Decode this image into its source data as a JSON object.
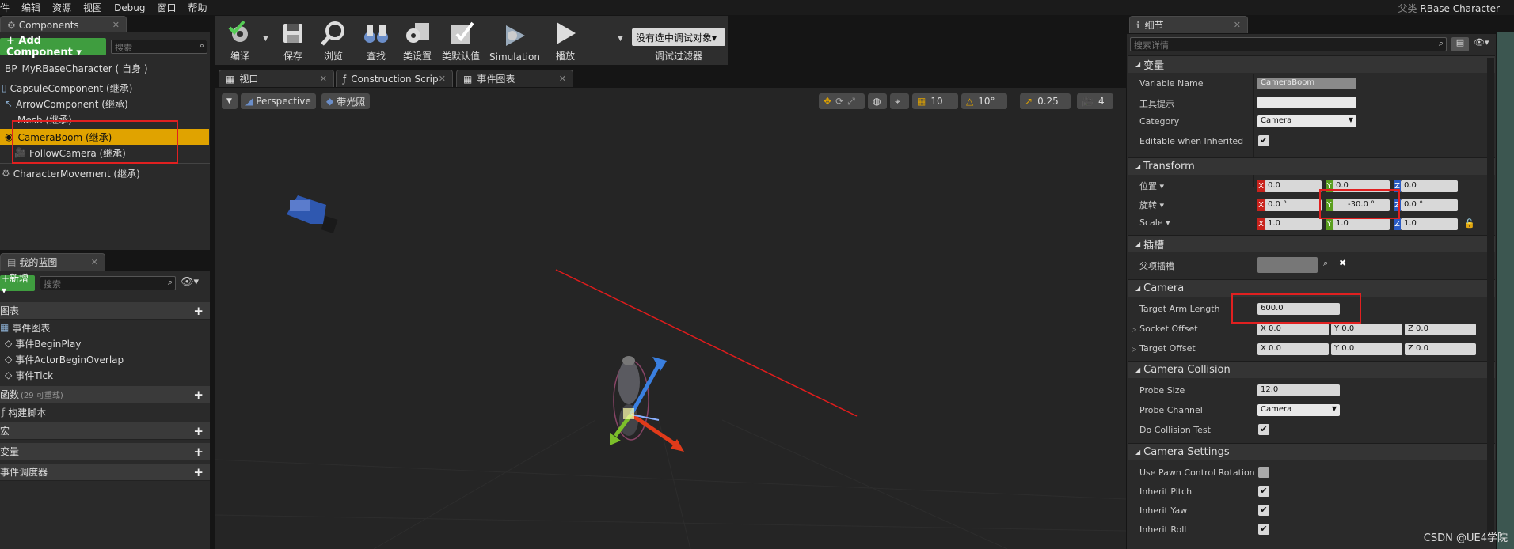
{
  "menu": [
    "件",
    "编辑",
    "资源",
    "视图",
    "Debug",
    "窗口",
    "帮助"
  ],
  "parent": {
    "label": "父类",
    "name": "RBase Character"
  },
  "components": {
    "tab": "Components",
    "add_button": "+ Add Component ▾",
    "search_placeholder": "搜索",
    "root": "BP_MyRBaseCharacter ( 自身 )",
    "items": [
      "CapsuleComponent (继承)",
      "ArrowComponent (继承)",
      "Mesh (继承)",
      "CameraBoom (继承)",
      "FollowCamera (继承)",
      "CharacterMovement (继承)"
    ]
  },
  "blueprint": {
    "tab": "我的蓝图",
    "new_button": "+新增 ▾",
    "search_placeholder": "搜索",
    "graphs_header": "图表",
    "event_graph": "事件图表",
    "events": [
      "事件BeginPlay",
      "事件ActorBeginOverlap",
      "事件Tick"
    ],
    "functions_header": "函数",
    "functions_count": "(29 可重载)",
    "construction": "构建脚本",
    "macros_header": "宏",
    "variables_header": "变量",
    "dispatchers_header": "事件调度器"
  },
  "toolbar": {
    "compile": "编译",
    "save": "保存",
    "browse": "浏览",
    "find": "查找",
    "class_settings": "类设置",
    "class_defaults": "类默认值",
    "simulation": "Simulation",
    "play": "播放",
    "debug_select": "没有选中调试对象▾",
    "debug_filter": "调试过滤器"
  },
  "viewport_tabs": [
    "视口",
    "Construction Scrip",
    "事件图表"
  ],
  "viewport": {
    "perspective": "Perspective",
    "lit": "带光照",
    "grid": "10",
    "angle": "10°",
    "scale": "0.25",
    "speed": "4"
  },
  "details": {
    "tab": "细节",
    "search_placeholder": "搜索详情",
    "variable": {
      "header": "变量",
      "name_label": "Variable Name",
      "name_value": "CameraBoom",
      "tooltip_label": "工具提示",
      "category_label": "Category",
      "category_value": "Camera",
      "editable_label": "Editable when Inherited"
    },
    "transform": {
      "header": "Transform",
      "location_label": "位置 ▾",
      "loc": [
        "0.0",
        "0.0",
        "0.0"
      ],
      "rotation_label": "旋转 ▾",
      "rot": [
        "0.0 °",
        "-30.0 °",
        "0.0 °"
      ],
      "scale_label": "Scale ▾",
      "scl": [
        "1.0",
        "1.0",
        "1.0"
      ]
    },
    "socket": {
      "header": "插槽",
      "parent_socket_label": "父项插槽"
    },
    "camera": {
      "header": "Camera",
      "arm_label": "Target Arm Length",
      "arm_value": "600.0",
      "socket_offset_label": "Socket Offset",
      "socket_offset": [
        "0.0",
        "0.0",
        "0.0"
      ],
      "target_offset_label": "Target Offset",
      "target_offset": [
        "0.0",
        "0.0",
        "0.0"
      ]
    },
    "collision": {
      "header": "Camera Collision",
      "probe_size_label": "Probe Size",
      "probe_size": "12.0",
      "probe_channel_label": "Probe Channel",
      "probe_channel": "Camera",
      "do_collision_label": "Do Collision Test"
    },
    "settings": {
      "header": "Camera Settings",
      "pawn_rot_label": "Use Pawn Control Rotation",
      "pitch_label": "Inherit Pitch",
      "yaw_label": "Inherit Yaw",
      "roll_label": "Inherit Roll"
    }
  },
  "watermark": "CSDN @UE4学院",
  "colors": {
    "selected": "#e0a300",
    "highlight_box": "#e02020",
    "add_green": "#3f9d3f"
  }
}
